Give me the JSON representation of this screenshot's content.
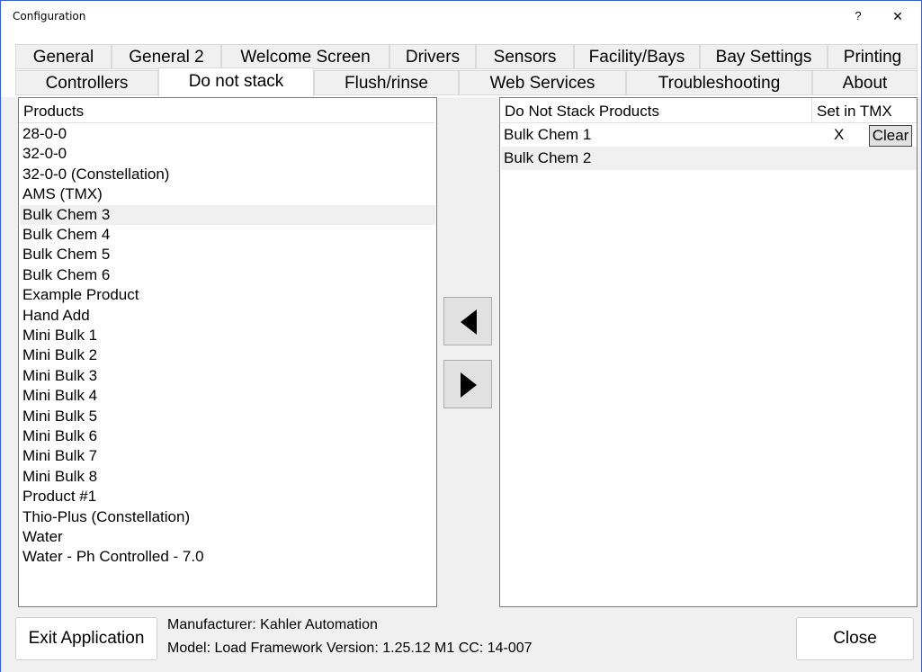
{
  "window": {
    "title": "Configuration",
    "help": "?",
    "close": "✕"
  },
  "tabs": {
    "row1": [
      "General",
      "General 2",
      "Welcome Screen",
      "Drivers",
      "Sensors",
      "Facility/Bays",
      "Bay Settings",
      "Printing"
    ],
    "row2": [
      "Controllers",
      "Do not stack",
      "Flush/rinse",
      "Web Services",
      "Troubleshooting",
      "About"
    ],
    "selected": "Do not stack"
  },
  "products": {
    "header": "Products",
    "items": [
      "28-0-0",
      "32-0-0",
      "32-0-0 (Constellation)",
      "AMS (TMX)",
      "Bulk Chem 3",
      "Bulk Chem 4",
      "Bulk Chem 5",
      "Bulk Chem 6",
      "Example Product",
      "Hand Add",
      "Mini Bulk 1",
      "Mini Bulk 2",
      "Mini Bulk 3",
      "Mini Bulk 4",
      "Mini Bulk 5",
      "Mini Bulk 6",
      "Mini Bulk 7",
      "Mini Bulk 8",
      "Product #1",
      "Thio-Plus (Constellation)",
      "Water",
      "Water - Ph Controlled - 7.0"
    ],
    "selected": "Bulk Chem 3"
  },
  "do_not_stack": {
    "header_products": "Do Not Stack Products",
    "header_set": "Set in TMX",
    "rows": [
      {
        "name": "Bulk Chem 1",
        "set": "X",
        "clear": "Clear"
      },
      {
        "name": "Bulk Chem 2"
      }
    ]
  },
  "footer": {
    "exit": "Exit Application",
    "manufacturer": "Manufacturer: Kahler Automation",
    "model": "Model: Load Framework Version: 1.25.12 M1 CC: 14-007",
    "close": "Close"
  }
}
